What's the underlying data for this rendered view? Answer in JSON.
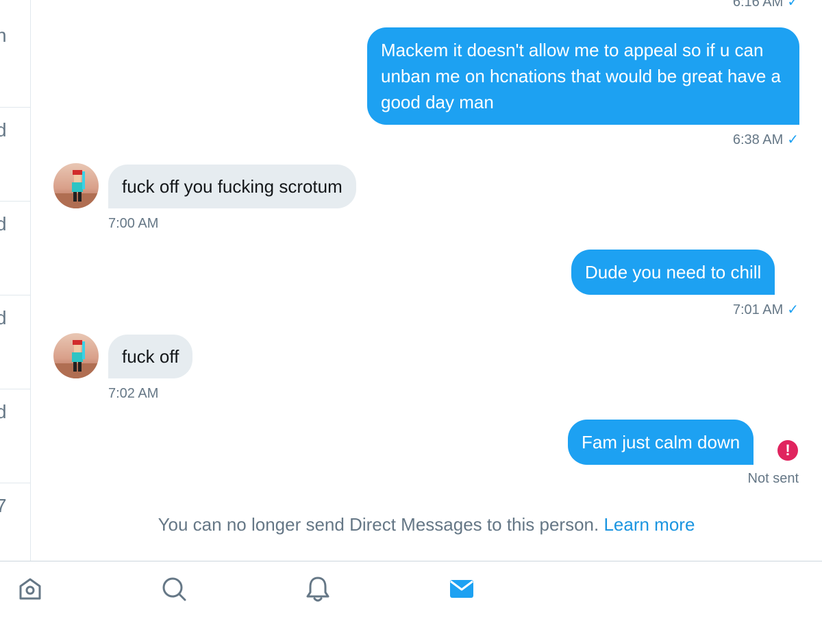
{
  "sidebar": {
    "fragments": [
      "n",
      "d",
      "d",
      "d",
      "d",
      "7"
    ]
  },
  "messages": {
    "top_timestamp": "6:16 AM",
    "m1": {
      "text": "Mackem it doesn't allow me to appeal so if u can unban me on hcnations that would be great have a good day man",
      "time": "6:38 AM",
      "status_icon": "checkmark-icon"
    },
    "m2": {
      "text": "fuck off you fucking scrotum",
      "time": "7:00 AM"
    },
    "m3": {
      "text": "Dude you need to chill",
      "time": "7:01 AM",
      "status_icon": "checkmark-icon"
    },
    "m4": {
      "text": "fuck off",
      "time": "7:02 AM"
    },
    "m5": {
      "text": "Fam just calm down",
      "status": "Not sent",
      "error_glyph": "!"
    }
  },
  "notice": {
    "text": "You can no longer send Direct Messages to this person.",
    "link": "Learn more"
  },
  "colors": {
    "accent": "#1da1f2",
    "incoming_bubble": "#e6ecf0",
    "error": "#e0245e",
    "muted_text": "#657786"
  },
  "tabbar": {
    "icons": [
      "home-icon",
      "search-icon",
      "notifications-icon",
      "messages-icon"
    ],
    "active": "messages-icon"
  }
}
